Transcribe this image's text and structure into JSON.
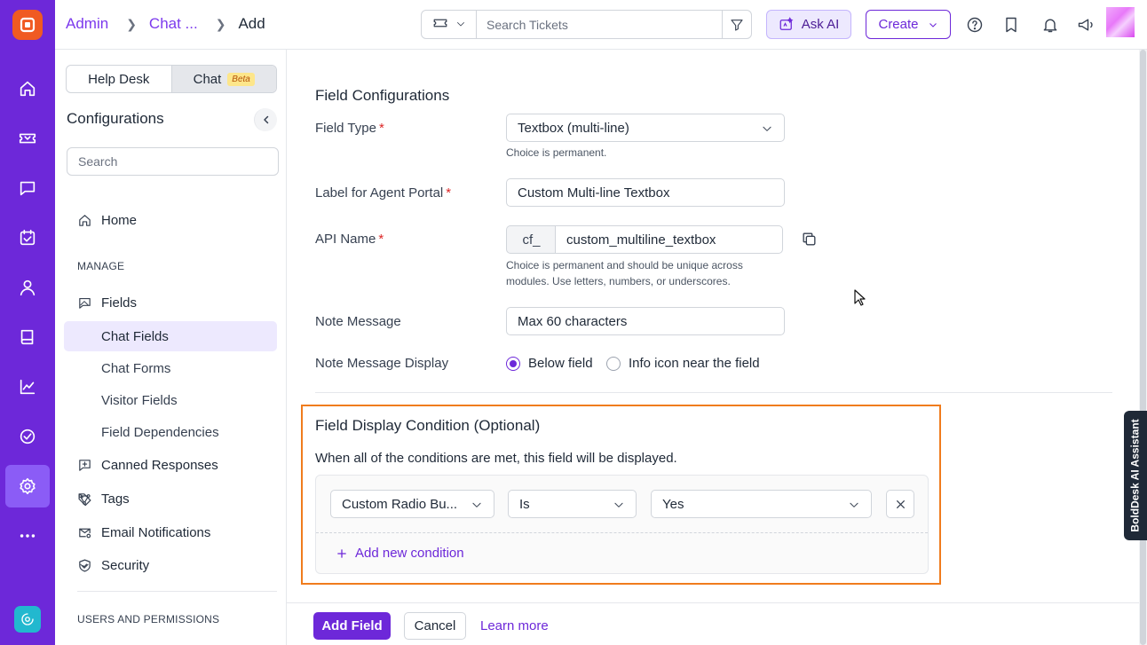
{
  "breadcrumb": {
    "admin": "Admin",
    "chat": "Chat ...",
    "current": "Add"
  },
  "topbar": {
    "search_placeholder": "Search Tickets",
    "ask_ai_label": "Ask AI",
    "create_label": "Create"
  },
  "sidebar": {
    "tabs": {
      "helpdesk": "Help Desk",
      "chat": "Chat",
      "beta": "Beta"
    },
    "title": "Configurations",
    "search_placeholder": "Search",
    "home": "Home",
    "manage_label": "MANAGE",
    "fields": "Fields",
    "sub_items": [
      "Chat Fields",
      "Chat Forms",
      "Visitor Fields",
      "Field Dependencies"
    ],
    "canned": "Canned Responses",
    "tags": "Tags",
    "email_notifications": "Email Notifications",
    "security": "Security",
    "users_permissions_label": "USERS AND PERMISSIONS"
  },
  "form": {
    "section_title": "Field Configurations",
    "field_type_label": "Field Type",
    "field_type_value": "Textbox (multi-line)",
    "field_type_help": "Choice is permanent.",
    "agent_label": "Label for Agent Portal",
    "agent_value": "Custom Multi-line Textbox",
    "api_label": "API Name",
    "api_prefix": "cf_",
    "api_value": "custom_multiline_textbox",
    "api_help_1": "Choice is permanent and should be unique across",
    "api_help_2": "modules. Use letters, numbers, or underscores.",
    "note_label": "Note Message",
    "note_value": "Max 60 characters",
    "display_label": "Note Message Display",
    "display_opt_1": "Below field",
    "display_opt_2": "Info icon near the field",
    "required_mark": "*"
  },
  "condition": {
    "title": "Field Display Condition (Optional)",
    "description": "When all of the conditions are met, this field will be displayed.",
    "field_value": "Custom Radio Bu...",
    "operator_value": "Is",
    "value_value": "Yes",
    "add_label": "Add new condition"
  },
  "footer": {
    "add_label": "Add Field",
    "cancel_label": "Cancel",
    "learn_label": "Learn more"
  },
  "assistant_tab": "BoldDesk AI Assistant",
  "colors": {
    "brand": "#6d28d9",
    "highlight": "#f07c1d"
  }
}
